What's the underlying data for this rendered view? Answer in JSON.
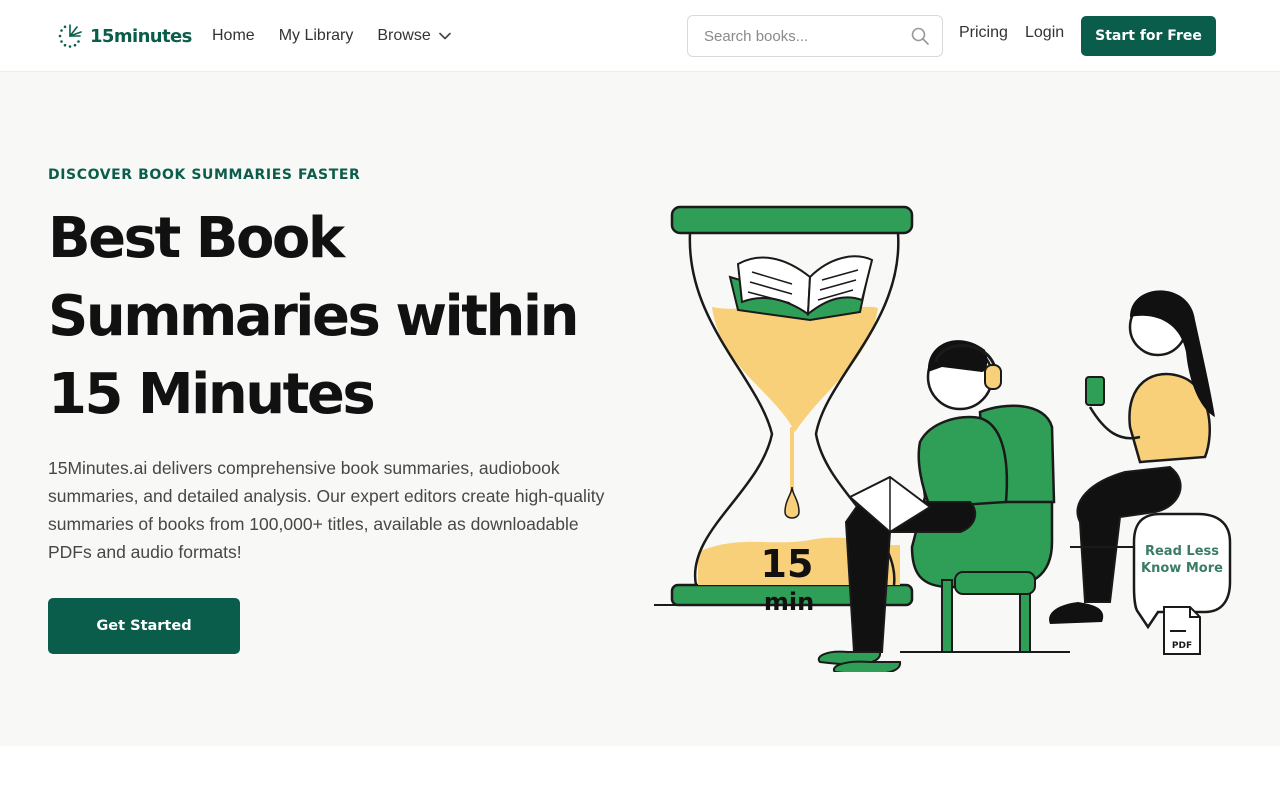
{
  "brand": {
    "name": "15minutes",
    "accent_color": "#0b5d4b",
    "sand_color": "#f8d07a",
    "green_color": "#2f9e57"
  },
  "nav": {
    "home": "Home",
    "library": "My Library",
    "browse": "Browse"
  },
  "search": {
    "placeholder": "Search books..."
  },
  "header": {
    "pricing": "Pricing",
    "login": "Login",
    "cta": "Start for Free"
  },
  "hero": {
    "eyebrow": "DISCOVER BOOK SUMMARIES FASTER",
    "headline_lines": [
      "Best Book",
      "Summaries within",
      "15 Minutes"
    ],
    "description": "15Minutes.ai delivers comprehensive book summaries, audiobook summaries, and detailed analysis. Our expert editors create high-quality summaries of books from 100,000+ titles, available as downloadable PDFs and audio formats!",
    "button": "Get Started"
  },
  "illustration": {
    "timer_number": "15",
    "timer_unit": "min",
    "bubble_line1": "Read Less",
    "bubble_line2": "Know More",
    "doc_label": "PDF"
  }
}
